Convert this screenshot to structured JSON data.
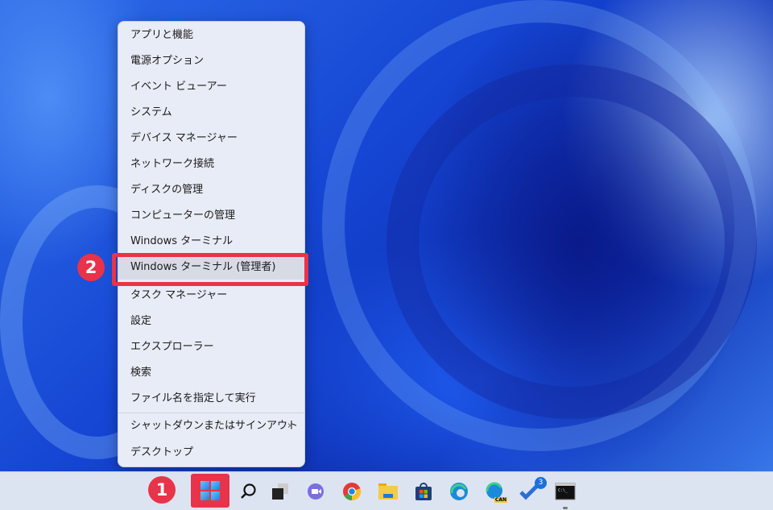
{
  "menu": {
    "items": [
      {
        "label": "アプリと機能"
      },
      {
        "label": "電源オプション"
      },
      {
        "label": "イベント ビューアー"
      },
      {
        "label": "システム"
      },
      {
        "label": "デバイス マネージャー"
      },
      {
        "label": "ネットワーク接続"
      },
      {
        "label": "ディスクの管理"
      },
      {
        "label": "コンピューターの管理"
      },
      {
        "label": "Windows ターミナル"
      },
      {
        "label": "Windows ターミナル (管理者)"
      },
      {
        "label": "タスク マネージャー"
      },
      {
        "label": "設定"
      },
      {
        "label": "エクスプローラー"
      },
      {
        "label": "検索"
      },
      {
        "label": "ファイル名を指定して実行"
      },
      {
        "label": "シャットダウンまたはサインアウト"
      },
      {
        "label": "デスクトップ"
      }
    ],
    "submenu_arrow": "›"
  },
  "annotations": {
    "step1": "1",
    "step2": "2",
    "color": "#e8334a"
  },
  "taskbar": {
    "icons": [
      "start-icon",
      "search-icon",
      "task-view-icon",
      "chat-icon",
      "chrome-icon",
      "file-explorer-icon",
      "store-icon",
      "edge-icon",
      "edge-canary-icon",
      "todo-icon",
      "terminal-icon"
    ],
    "todo_badge": "3",
    "canary_label": "CAN"
  }
}
